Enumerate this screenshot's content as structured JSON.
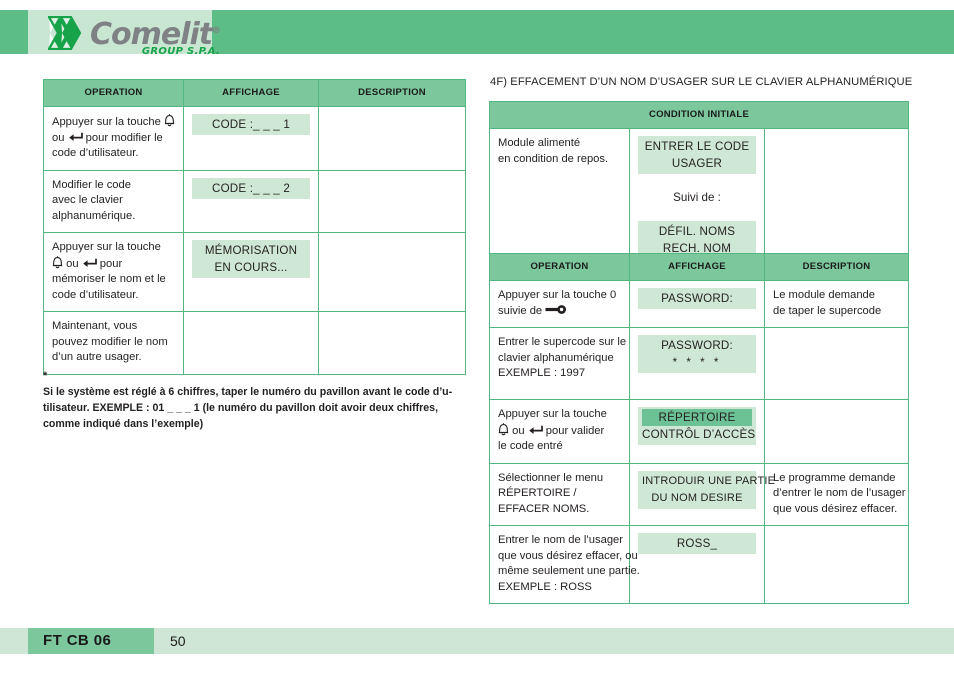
{
  "header": {
    "brand": "Comelit",
    "registered_mark": "®",
    "subtitle": "GROUP S.P.A.",
    "brand_color": "#7f8285",
    "accent_color": "#16a34a",
    "band_color": "#5cbd87",
    "plate_color": "#c9e6d3"
  },
  "left_table": {
    "columns": [
      "OPERATION",
      "AFFICHAGE",
      "DESCRIPTION"
    ],
    "rows": [
      {
        "operation_lines": [
          "Appuyer sur la touche {bell}",
          "ou {enter} pour modifier le",
          "code d’utilisateur."
        ],
        "display": {
          "line1": "CODE :_ _ _ 1",
          "line2": ""
        },
        "description_lines": []
      },
      {
        "operation_lines": [
          "Modifier le code",
          "avec le clavier",
          "alphanumérique."
        ],
        "display": {
          "line1": "CODE :_ _ _ 2",
          "line2": ""
        },
        "description_lines": []
      },
      {
        "operation_lines": [
          "Appuyer sur la touche",
          "{bell} ou {enter} pour",
          "mémoriser le nom et le",
          "code d’utilisateur."
        ],
        "display": {
          "line1": "MÉMORISATION",
          "line2": "EN COURS..."
        },
        "description_lines": []
      },
      {
        "operation_lines": [
          "Maintenant, vous",
          "pouvez modifier le nom",
          "d’un autre usager."
        ],
        "display": {
          "line1": "",
          "line2": ""
        },
        "description_lines": []
      }
    ]
  },
  "footnote": {
    "marker": "*",
    "lines": [
      "Si le système est réglé à 6 chiffres, taper le numéro du pavillon avant le code d’u-",
      "tilisateur. EXEMPLE : 01 _ _ _ 1 (le numéro du pavillon doit avoir deux chiffres,",
      "comme indiqué dans l’exemple)"
    ]
  },
  "right_section": {
    "title": "4F) EFFACEMENT D’UN NOM D’USAGER SUR LE CLAVIER ALPHANUMÉRIQUE",
    "initial_condition": {
      "header": "CONDITION INITIALE",
      "operation_lines": [
        "Module alimenté",
        "en condition de repos."
      ],
      "display_first": {
        "line1": "ENTRER LE CODE",
        "line2": "USAGER"
      },
      "display_middle_text": "Suivi de :",
      "display_second": {
        "line1": "DÉFIL. NOMS",
        "line2": "RECH. NOM"
      },
      "description_lines": []
    },
    "table": {
      "columns": [
        "OPERATION",
        "AFFICHAGE",
        "DESCRIPTION"
      ],
      "rows": [
        {
          "operation_lines": [
            "Appuyer sur la touche 0",
            "suivie de {key}"
          ],
          "display": {
            "line1": "PASSWORD:",
            "line2": ""
          },
          "description_lines": [
            "Le module demande",
            "de taper le supercode"
          ]
        },
        {
          "operation_lines": [
            "Entrer le supercode sur le",
            "clavier alphanumérique",
            "EXEMPLE : 1997"
          ],
          "display": {
            "line1": "PASSWORD:",
            "line2": "* * * *"
          },
          "description_lines": []
        },
        {
          "operation_lines": [
            "Appuyer sur la touche",
            "{bell} ou {enter} pour valider",
            "le code entré"
          ],
          "display": {
            "line1": "RÉPERTOIRE",
            "line2": "CONTRÔL D’ACCÈS",
            "line1_selected": true
          },
          "description_lines": []
        },
        {
          "operation_lines": [
            "Sélectionner le menu",
            "RÉPERTOIRE /",
            "EFFACER NOMS."
          ],
          "display": {
            "line1": "INTRODUIR UNE PARTIE",
            "line2": "DU NOM DESIRE"
          },
          "description_lines": [
            "Le programme demande",
            "d’entrer le nom de l’usager",
            "que vous désirez effacer."
          ]
        },
        {
          "operation_lines": [
            "Entrer le nom de l’usager",
            "que vous désirez effacer, ou",
            "même seulement une partie.",
            "EXEMPLE : ROSS"
          ],
          "display": {
            "line1": "ROSS_",
            "line2": ""
          },
          "description_lines": []
        }
      ]
    }
  },
  "footer": {
    "code": "FT CB 06",
    "page": "50",
    "band_color": "#7cc79b",
    "light_color": "#cfe6d6"
  },
  "icons": {
    "bell": "bell-icon",
    "enter": "enter-key-icon",
    "key": "key-icon"
  }
}
